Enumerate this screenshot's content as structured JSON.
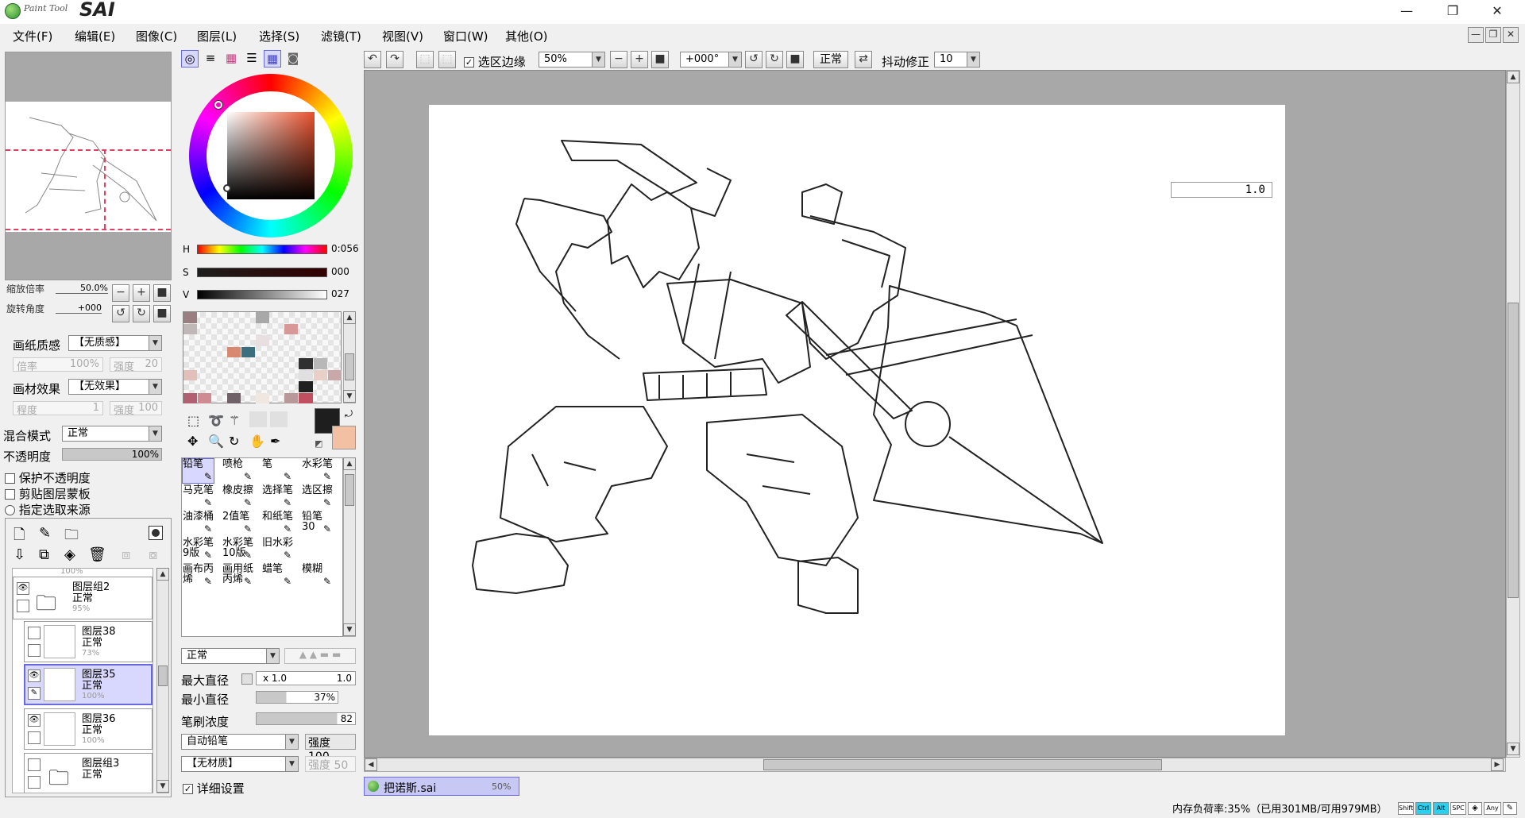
{
  "app": {
    "logo_small": "Paint Tool",
    "logo_big": "SAI"
  },
  "window_controls": {
    "minimize": "—",
    "restore": "❐",
    "close": "✕"
  },
  "menu": [
    "文件(F)",
    "编辑(E)",
    "图像(C)",
    "图层(L)",
    "选择(S)",
    "滤镜(T)",
    "视图(V)",
    "窗口(W)",
    "其他(O)"
  ],
  "navigator": {
    "zoom_label": "缩放倍率",
    "zoom_value": "50.0%",
    "rotate_label": "旋转角度",
    "rotate_value": "+000"
  },
  "paper_texture": {
    "label": "画纸质感",
    "value": "【无质感】",
    "rate_label": "倍率",
    "rate_value": "100%",
    "strength_label": "强度",
    "strength_value": "20"
  },
  "material_effect": {
    "label": "画材效果",
    "value": "【无效果】",
    "degree_label": "程度",
    "degree_value": "1",
    "strength_label": "强度",
    "strength_value": "100"
  },
  "blend": {
    "label": "混合模式",
    "value": "正常",
    "opacity_label": "不透明度",
    "opacity_value": "100%"
  },
  "layer_options": [
    "保护不透明度",
    "剪贴图层蒙板",
    "指定选取来源"
  ],
  "layers": [
    {
      "name": "图层组2",
      "mode": "正常",
      "opacity": "95%"
    },
    {
      "name": "图层38",
      "mode": "正常",
      "opacity": "73%"
    },
    {
      "name": "图层35",
      "mode": "正常",
      "opacity": "100%"
    },
    {
      "name": "图层36",
      "mode": "正常",
      "opacity": "100%"
    },
    {
      "name": "图层组3",
      "mode": "正常",
      "opacity": ""
    }
  ],
  "layers_partial_top": "100%",
  "color": {
    "h_label": "H",
    "h_value": "0:056",
    "s_label": "S",
    "s_value": "000",
    "v_label": "V",
    "v_value": "027",
    "primary": "#1e1e1e",
    "secondary": "#f4c0a4"
  },
  "swatches": [
    "#9a7f80",
    "",
    "",
    "",
    "",
    "#a8a8a8",
    "",
    "",
    "",
    "",
    "",
    "#c0b8b8",
    "",
    "",
    "",
    "",
    "",
    "",
    "#d89898",
    "",
    "",
    "",
    "",
    "",
    "",
    "",
    "",
    "#e8e0e0",
    "",
    "",
    "",
    "",
    "",
    "",
    "",
    "",
    "#d88870",
    "#3c6e7e",
    "",
    "",
    "",
    "",
    "",
    "",
    "",
    "",
    "",
    "",
    "",
    "",
    "",
    "",
    "#303030",
    "#b8b8b8",
    "",
    "#e0c0b8",
    "",
    "",
    "",
    "",
    "",
    "",
    "",
    "#e0e0e0",
    "#e8d0c8",
    "#c8a8a8",
    "",
    "",
    "",
    "",
    "",
    "",
    "",
    "",
    "#202020",
    "",
    "",
    "#b06070",
    "#d08a92",
    "",
    "#706068",
    "",
    "#f0e8e0",
    "",
    "#b89898",
    "#c05060",
    "",
    ""
  ],
  "tools": [
    {
      "label": "铅笔",
      "selected": true
    },
    {
      "label": "喷枪"
    },
    {
      "label": "笔"
    },
    {
      "label": "水彩笔"
    },
    {
      "label": "马克笔"
    },
    {
      "label": "橡皮擦"
    },
    {
      "label": "选择笔"
    },
    {
      "label": "选区擦"
    },
    {
      "label": "油漆桶"
    },
    {
      "label": "2值笔"
    },
    {
      "label": "和纸笔"
    },
    {
      "label": "铅笔30"
    },
    {
      "label": "水彩笔9版"
    },
    {
      "label": "水彩笔10版"
    },
    {
      "label": "旧水彩"
    },
    {
      "label": ""
    },
    {
      "label": "画布丙烯"
    },
    {
      "label": "画用纸丙烯"
    },
    {
      "label": "蜡笔"
    },
    {
      "label": "模糊"
    }
  ],
  "brush": {
    "mode": "正常",
    "max_size_label": "最大直径",
    "max_size_mult": "x 1.0",
    "max_size_value": "1.0",
    "min_size_label": "最小直径",
    "min_size_value": "37%",
    "density_label": "笔刷浓度",
    "density_value": "82",
    "shape": "自动铅笔",
    "shape_strength_label": "强度",
    "shape_strength_value": "100",
    "texture": "【无材质】",
    "texture_strength_label": "强度",
    "texture_strength_value": "50",
    "detail_label": "详细设置",
    "min_size_fraction": 0.37,
    "density_fraction": 0.82
  },
  "toolbar": {
    "select_edge_label": "选区边缘",
    "zoom": "50%",
    "angle": "+000°",
    "mode": "正常",
    "stabilizer_label": "抖动修正",
    "stabilizer_value": "10"
  },
  "canvas": {
    "brush_size_display": "1.0"
  },
  "doc_tab": {
    "name": "把诺斯.sai",
    "zoom": "50%"
  },
  "status": {
    "memory": "内存负荷率:35%（已用301MB/可用979MB）",
    "keys": [
      "Shift",
      "Ctrl",
      "Alt",
      "SPC",
      "◈",
      "Any",
      "✎"
    ]
  }
}
